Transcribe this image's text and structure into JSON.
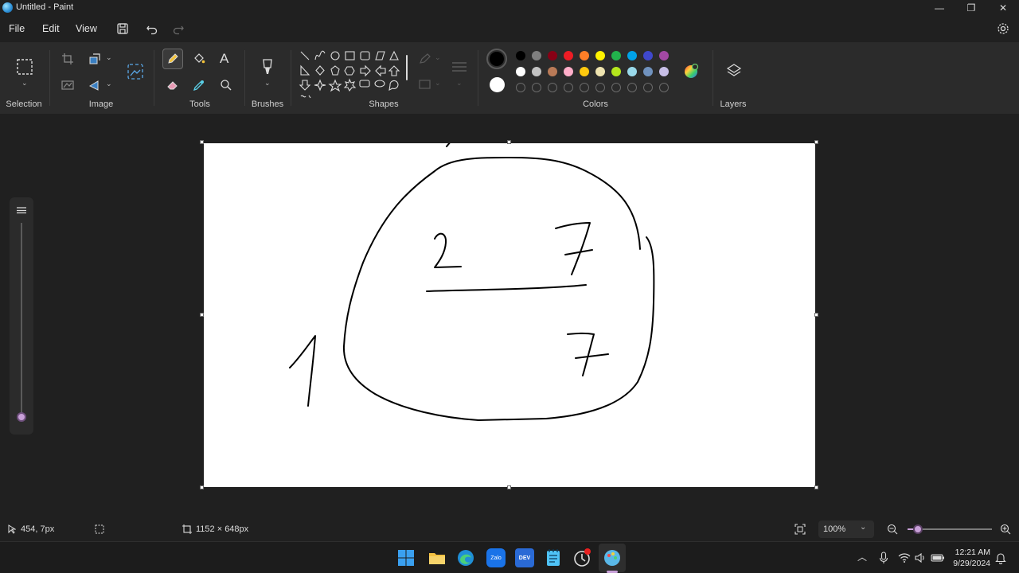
{
  "window": {
    "title": "Untitled - Paint",
    "minimize_glyph": "—",
    "restore_glyph": "❐",
    "close_glyph": "✕"
  },
  "menu": {
    "file": "File",
    "edit": "Edit",
    "view": "View"
  },
  "ribbon": {
    "groups": {
      "selection": "Selection",
      "image": "Image",
      "tools": "Tools",
      "brushes": "Brushes",
      "shapes": "Shapes",
      "colors": "Colors",
      "layers": "Layers"
    },
    "tools": {
      "text_glyph": "A"
    },
    "colors": {
      "primary": "#000000",
      "secondary": "#ffffff",
      "palette_row1": [
        "#000000",
        "#7f7f7f",
        "#880015",
        "#ed1c24",
        "#ff7f27",
        "#fff200",
        "#22b14c",
        "#00a2e8",
        "#3f48cc",
        "#a349a4"
      ],
      "palette_row2": [
        "#ffffff",
        "#c3c3c3",
        "#b97a57",
        "#ffaec9",
        "#ffc90e",
        "#efe4b0",
        "#b5e61d",
        "#99d9ea",
        "#7092be",
        "#c8bfe7"
      ]
    }
  },
  "status": {
    "cursor_position": "454, 7px",
    "canvas_size": "1152 × 648px",
    "zoom": "100%"
  },
  "taskbar": {
    "time": "12:21 AM",
    "date": "9/29/2024",
    "zalo_label": "Zalo",
    "dev_label": "DEV"
  }
}
